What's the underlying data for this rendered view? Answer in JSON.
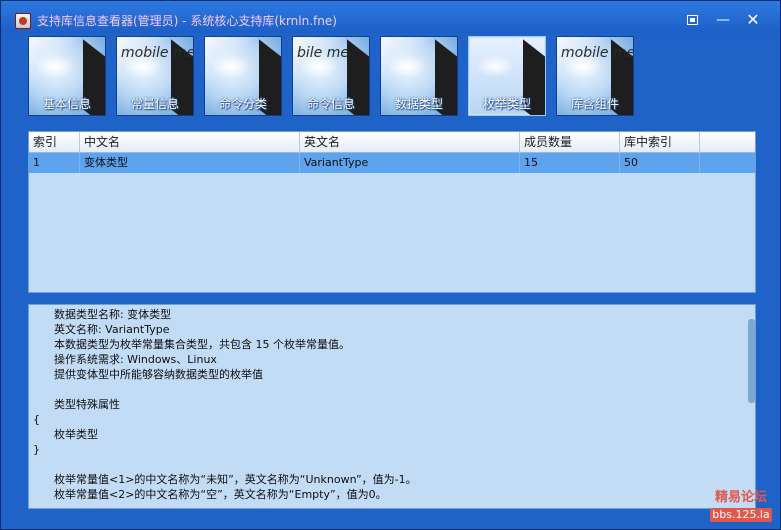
{
  "window": {
    "title": "支持库信息查看器(管理员) - 系统核心支持库(krnln.fne)"
  },
  "toolbar": {
    "items": [
      {
        "label": "基本信息",
        "brand": ""
      },
      {
        "label": "常量信息",
        "brand": "mobile me"
      },
      {
        "label": "命令分类",
        "brand": ""
      },
      {
        "label": "命令信息",
        "brand": "bile me"
      },
      {
        "label": "数据类型",
        "brand": ""
      },
      {
        "label": "枚举类型",
        "brand": ""
      },
      {
        "label": "库含组件",
        "brand": "mobile me"
      }
    ]
  },
  "table": {
    "headers": [
      "索引",
      "中文名",
      "英文名",
      "成员数量",
      "库中索引",
      ""
    ],
    "rows": [
      [
        "1",
        "变体类型",
        "VariantType",
        "15",
        "50",
        ""
      ]
    ]
  },
  "details": {
    "lines": [
      {
        "text": "      数据类型名称: 变体类型",
        "mono": false
      },
      {
        "text": "      英文名称: VariantType",
        "mono": false
      },
      {
        "text": "      本数据类型为枚举常量集合类型，共包含 15 个枚举常量值。",
        "mono": false
      },
      {
        "text": "      操作系统需求: Windows、Linux",
        "mono": false
      },
      {
        "text": "      提供变体型中所能够容纳数据类型的枚举值",
        "mono": false
      },
      {
        "text": "",
        "mono": false
      },
      {
        "text": "      类型特殊属性",
        "mono": false
      },
      {
        "text": "{",
        "mono": false
      },
      {
        "text": "      枚举类型",
        "mono": false
      },
      {
        "text": "}",
        "mono": false
      },
      {
        "text": "",
        "mono": false
      },
      {
        "text": "      枚举常量值<1>的中文名称为“未知”，英文名称为“Unknown”，值为-1。",
        "mono": false
      },
      {
        "text": "      枚举常量值<2>的中文名称为“空”，英文名称为“Empty”，值为0。",
        "mono": false
      }
    ]
  },
  "watermark": {
    "line1": "精易论坛",
    "line2": "bbs.125.la"
  }
}
